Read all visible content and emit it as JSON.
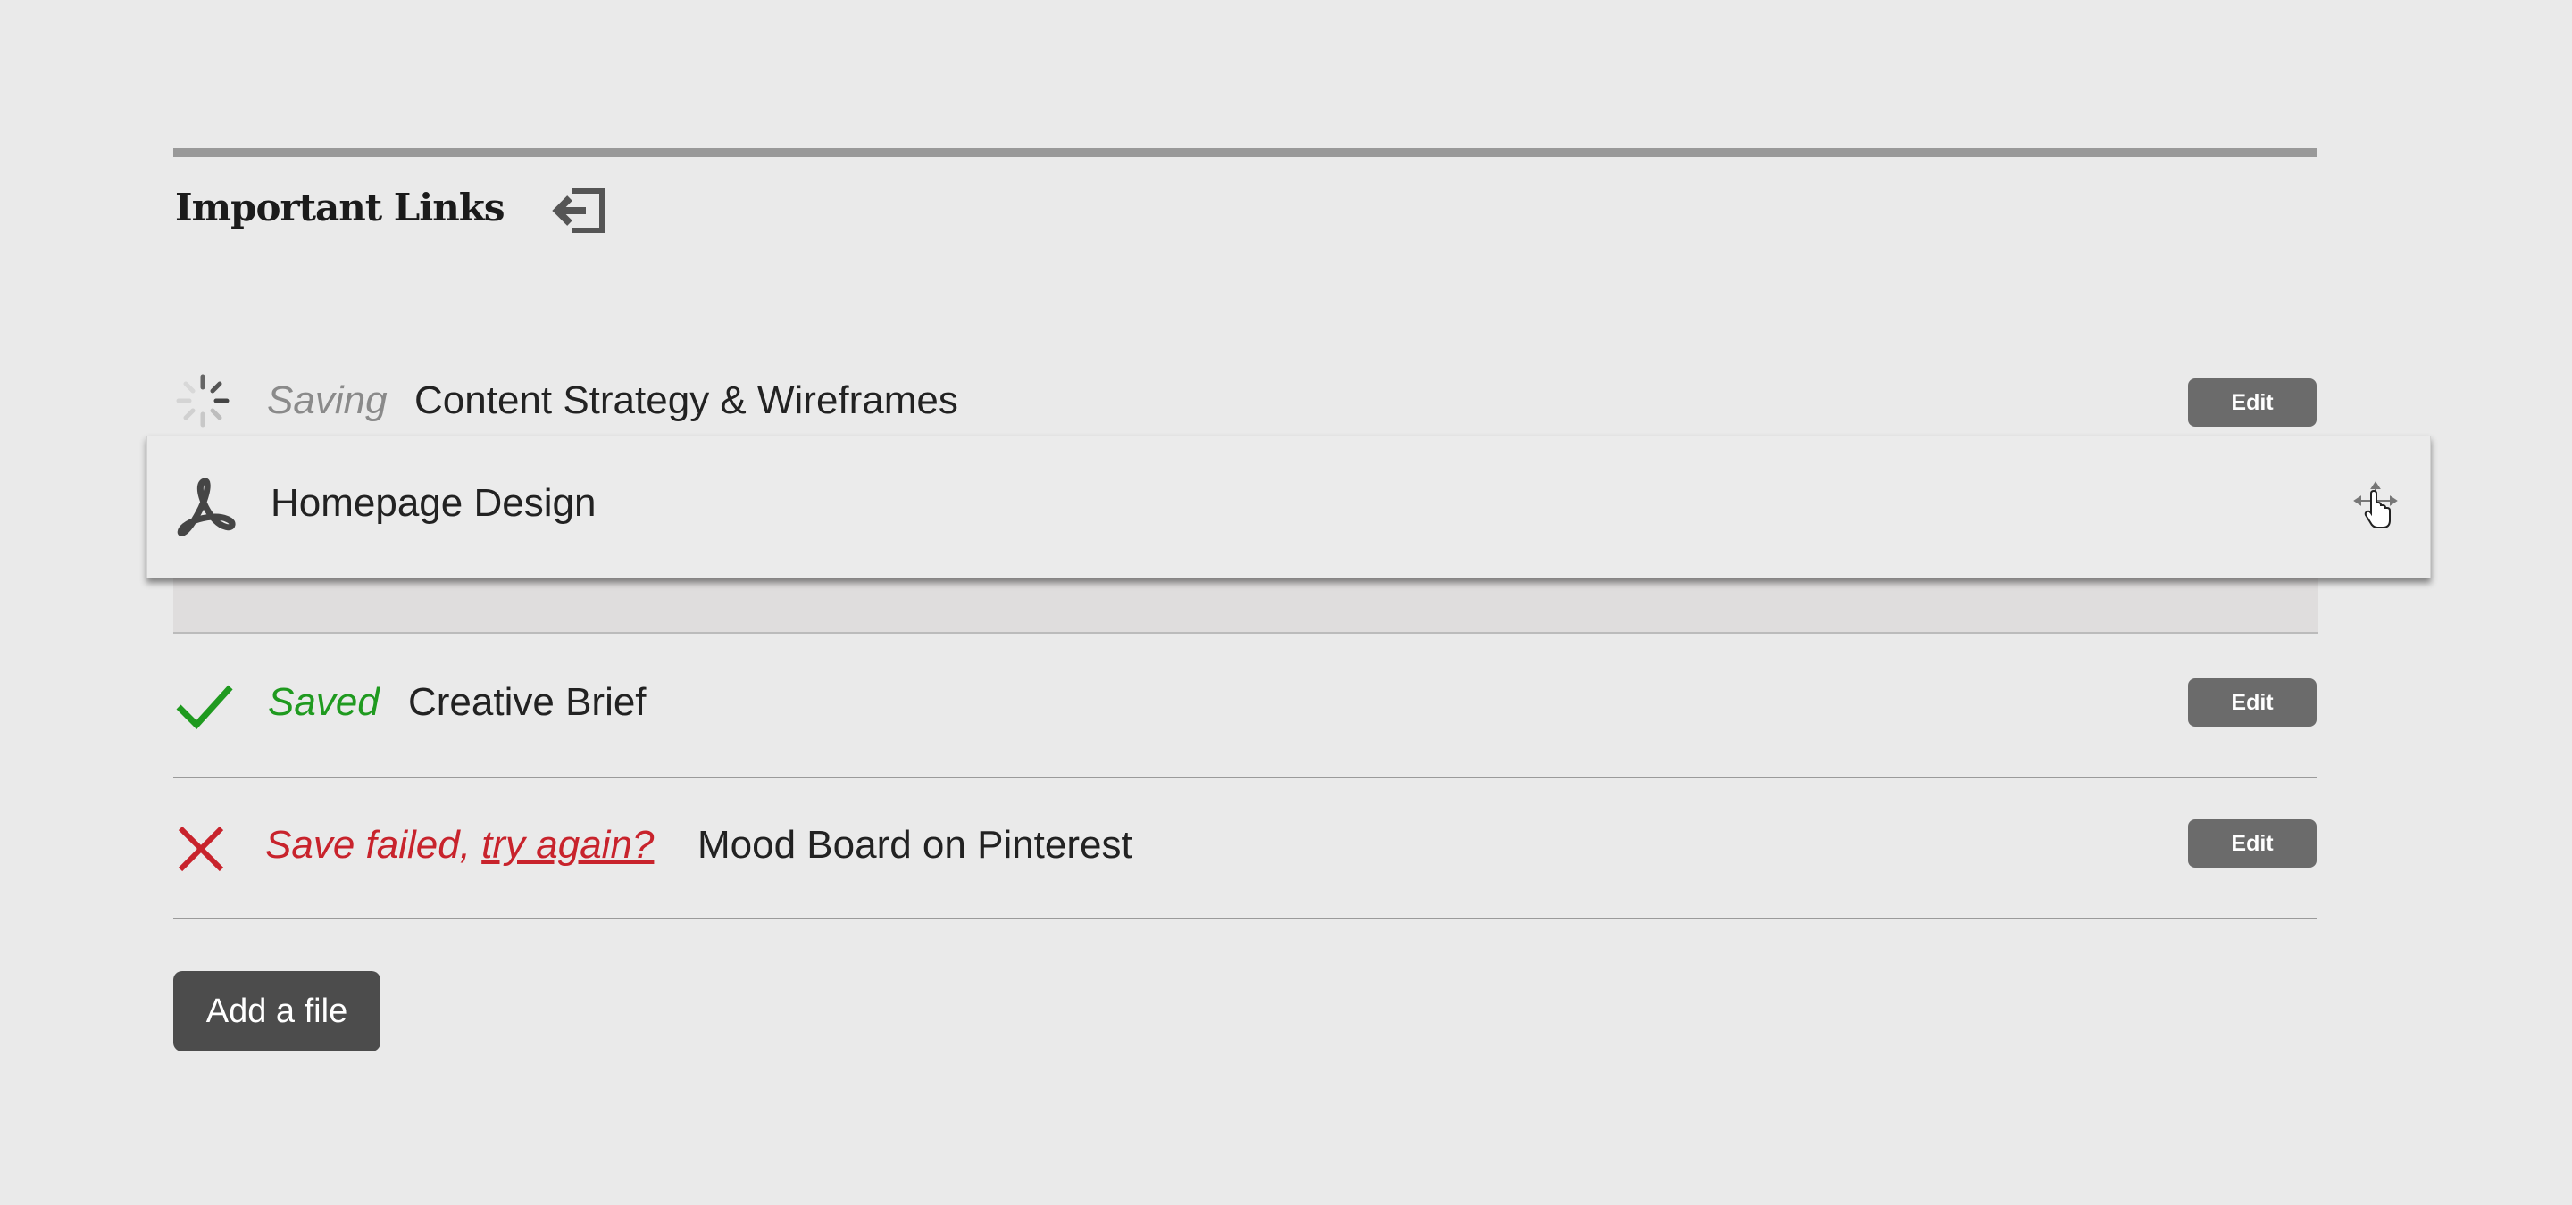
{
  "section": {
    "title": "Important Links",
    "header_icon": "collapse-arrow-icon"
  },
  "rows": [
    {
      "status": "Saving",
      "status_icon": "spinner-icon",
      "name": "Content Strategy & Wireframes",
      "edit_label": "Edit"
    },
    {
      "status": "Saved",
      "status_icon": "checkmark-icon",
      "name": "Creative Brief",
      "edit_label": "Edit"
    },
    {
      "status_prefix": "Save failed,",
      "retry_label": "try again?",
      "status_icon": "error-x-icon",
      "name": "Mood Board on Pinterest",
      "edit_label": "Edit"
    }
  ],
  "dragged_item": {
    "name": "Homepage Design",
    "file_icon": "pdf-icon",
    "handle_icon": "move-handle-icon"
  },
  "add_file_label": "Add a file",
  "colors": {
    "background": "#eaeaea",
    "saving": "#8a8a8a",
    "saved": "#1f9a1f",
    "failed": "#c8232c",
    "edit_button": "#6b6b6b",
    "add_button": "#4c4c4c"
  }
}
